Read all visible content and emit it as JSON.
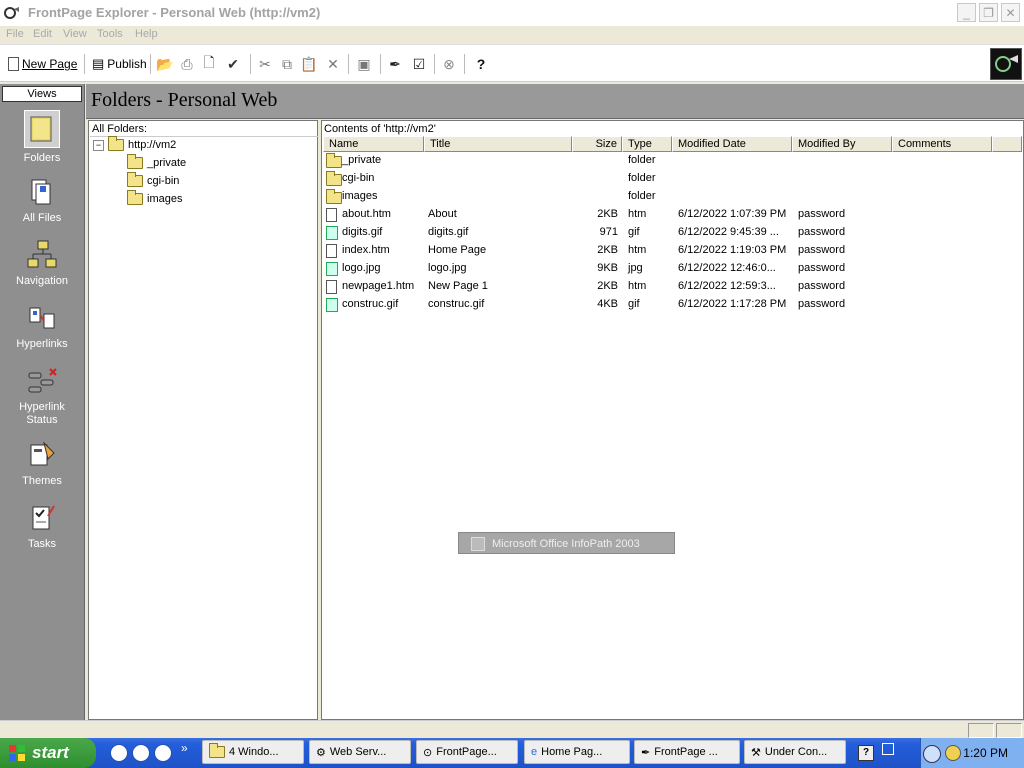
{
  "window": {
    "title": "FrontPage Explorer - Personal Web (http://vm2)",
    "controls": [
      "_",
      "❐",
      "✕"
    ]
  },
  "menu": [
    "File",
    "Edit",
    "View",
    "Tools",
    "Help"
  ],
  "toolbar": {
    "new_page": "New Page",
    "publish": "Publish"
  },
  "views": {
    "header": "Views",
    "items": [
      {
        "label": "Folders",
        "icon": "folder-icon"
      },
      {
        "label": "All Files",
        "icon": "all-files-icon"
      },
      {
        "label": "Navigation",
        "icon": "navigation-icon"
      },
      {
        "label": "Hyperlinks",
        "icon": "hyperlinks-icon"
      },
      {
        "label": "Hyperlink\nStatus",
        "icon": "hyperlink-status-icon"
      },
      {
        "label": "Themes",
        "icon": "themes-icon"
      },
      {
        "label": "Tasks",
        "icon": "tasks-icon"
      }
    ]
  },
  "main": {
    "title": "Folders - Personal Web"
  },
  "folder_tree": {
    "header": "All Folders:",
    "root": "http://vm2",
    "root_toggle": "−",
    "children": [
      "_private",
      "cgi-bin",
      "images"
    ]
  },
  "contents": {
    "header": "Contents of 'http://vm2'",
    "columns": [
      "Name",
      "Title",
      "Size",
      "Type",
      "Modified Date",
      "Modified By",
      "Comments"
    ],
    "rows": [
      {
        "icon": "folder",
        "name": "_private",
        "title": "",
        "size": "",
        "type": "folder",
        "modified": "",
        "by": ""
      },
      {
        "icon": "folder",
        "name": "cgi-bin",
        "title": "",
        "size": "",
        "type": "folder",
        "modified": "",
        "by": ""
      },
      {
        "icon": "folder",
        "name": "images",
        "title": "",
        "size": "",
        "type": "folder",
        "modified": "",
        "by": ""
      },
      {
        "icon": "page",
        "name": "about.htm",
        "title": "About",
        "size": "2KB",
        "type": "htm",
        "modified": "6/12/2022 1:07:39 PM",
        "by": "password"
      },
      {
        "icon": "image",
        "name": "digits.gif",
        "title": "digits.gif",
        "size": "971",
        "type": "gif",
        "modified": "6/12/2022 9:45:39 ...",
        "by": "password"
      },
      {
        "icon": "page",
        "name": "index.htm",
        "title": "Home Page",
        "size": "2KB",
        "type": "htm",
        "modified": "6/12/2022 1:19:03 PM",
        "by": "password"
      },
      {
        "icon": "image",
        "name": "logo.jpg",
        "title": "logo.jpg",
        "size": "9KB",
        "type": "jpg",
        "modified": "6/12/2022 12:46:0...",
        "by": "password"
      },
      {
        "icon": "page",
        "name": "newpage1.htm",
        "title": "New Page 1",
        "size": "2KB",
        "type": "htm",
        "modified": "6/12/2022 12:59:3...",
        "by": "password"
      },
      {
        "icon": "image",
        "name": "construc.gif",
        "title": "construc.gif",
        "size": "4KB",
        "type": "gif",
        "modified": "6/12/2022 1:17:28 PM",
        "by": "password"
      }
    ]
  },
  "popup": {
    "text": "Microsoft Office InfoPath 2003"
  },
  "taskbar": {
    "start": "start",
    "chevron": "»",
    "items": [
      "4 Windo...",
      "Web Serv...",
      "FrontPage...",
      "Home Pag...",
      "FrontPage ...",
      "Under Con..."
    ],
    "clock": "1:20 PM"
  }
}
